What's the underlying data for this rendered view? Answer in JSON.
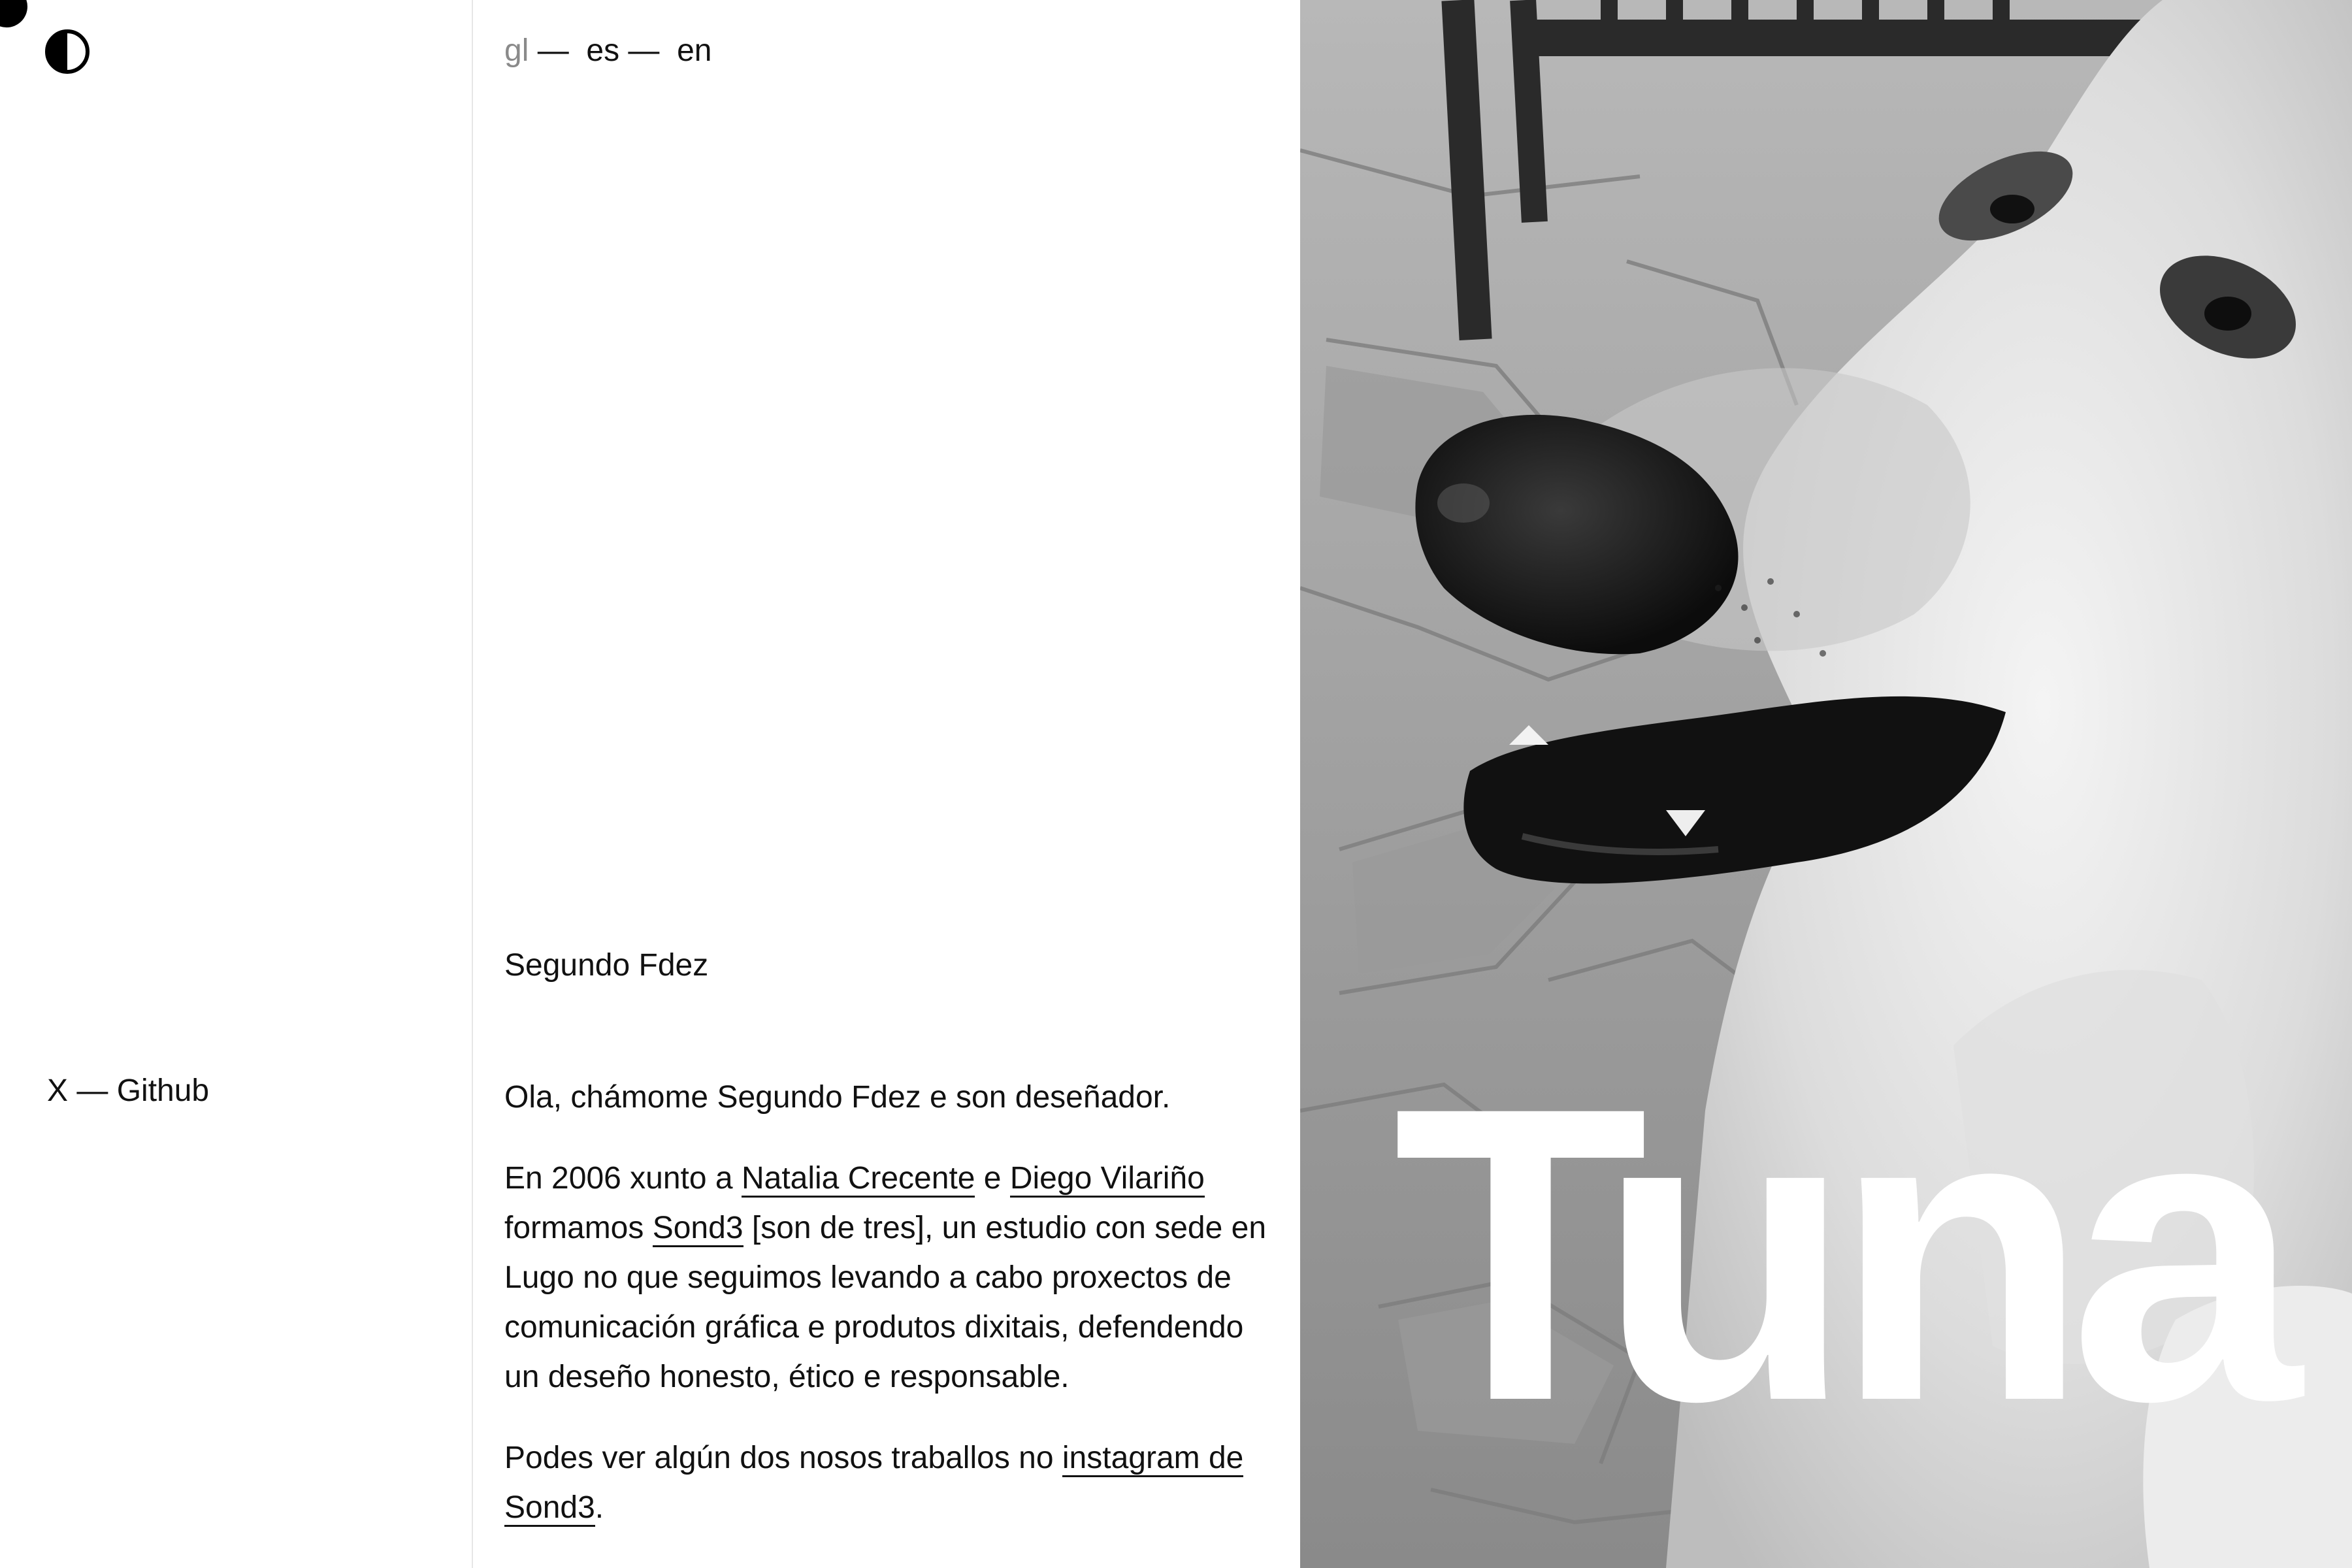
{
  "sidebar": {
    "theme_toggle_icon": "contrast-half-circle-icon",
    "social": {
      "x_label": "X",
      "separator": " — ",
      "github_label": "Github"
    }
  },
  "languages": {
    "items": [
      {
        "label": "gl",
        "active": true
      },
      {
        "label": "es",
        "active": false
      },
      {
        "label": "en",
        "active": false
      }
    ],
    "separator": "—"
  },
  "profile": {
    "name": "Segundo Fdez",
    "intro": "Ola, chámome Segundo Fdez e son deseñador.",
    "p2_part1": "En 2006 xunto a ",
    "link_natalia": "Natalia Crecente",
    "p2_part2": " e ",
    "link_diego": "Diego Vilariño",
    "p2_part3": " formamos ",
    "link_sond3": "Sond3",
    "p2_part4": " [son de tres], un estudio con sede en Lugo no que seguimos levando a cabo proxectos de comunicación gráfica e produtos dixitais, defen­dendo un deseño honesto, ético e responsable.",
    "p3_part1": "Podes ver algún dos nosos traballos no ",
    "link_instagram": "instagram de Sond3",
    "p3_part2": "."
  },
  "hero": {
    "title": "Tuna",
    "photo_subject": "dog-photo"
  },
  "colors": {
    "background": "#ffffff",
    "text": "#111111",
    "muted": "#8a8a8a",
    "title": "#ffffff"
  }
}
